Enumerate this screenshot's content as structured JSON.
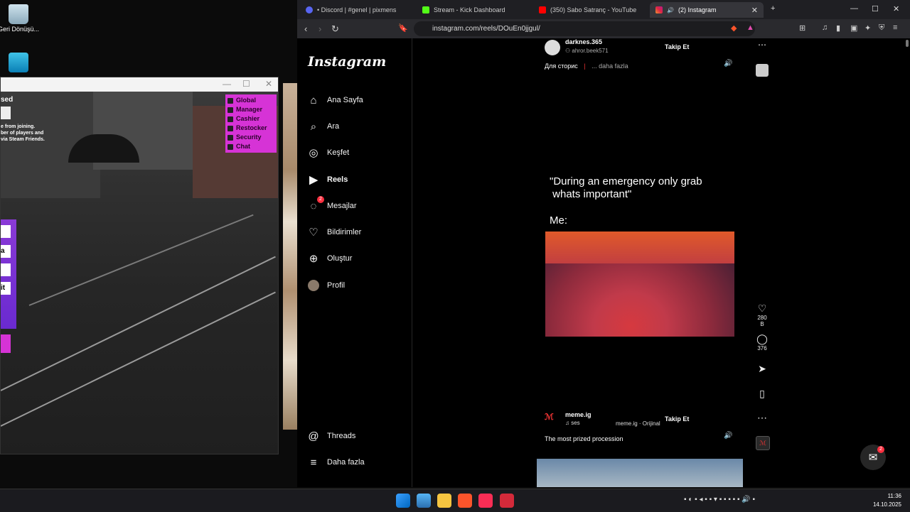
{
  "desktop": {
    "icons": [
      {
        "label": "Geri Dönüşü...",
        "icon": "recycle-bin-icon"
      },
      {
        "label": "",
        "icon": "monitor-icon"
      }
    ]
  },
  "game_window": {
    "title": "",
    "overlay_text": "sed",
    "info_lines": [
      "e from joining.",
      "ber of players and",
      "via Steam Friends."
    ],
    "menu": [
      {
        "label": "Global",
        "icon": "globe-icon"
      },
      {
        "label": "Manager",
        "icon": "user-icon"
      },
      {
        "label": "Cashier",
        "icon": "dollar-icon"
      },
      {
        "label": "Restocker",
        "icon": "box-icon"
      },
      {
        "label": "Security",
        "icon": "shield-icon"
      },
      {
        "label": "Chat",
        "icon": "chat-icon"
      }
    ],
    "side_panel": {
      "button_label": "it",
      "box_a": "",
      "box_b": "a"
    }
  },
  "browser": {
    "tabs": [
      {
        "label": "• Discord | #genel | pixmens",
        "icon": "discord-icon",
        "color": "#5865f2",
        "active": false
      },
      {
        "label": "Stream - Kick Dashboard",
        "icon": "kick-icon",
        "color": "#53fc18",
        "active": false
      },
      {
        "label": "(350) Sabo Satranç - YouTube",
        "icon": "youtube-icon",
        "color": "#ff0000",
        "active": false
      },
      {
        "label": "(2) Instagram",
        "icon": "instagram-icon",
        "color": "#e1306c",
        "active": true
      }
    ],
    "url": "instagram.com/reels/DOuEn0jjgul/"
  },
  "instagram": {
    "logo": "Instagram",
    "nav": [
      {
        "label": "Ana Sayfa",
        "icon": "home-icon"
      },
      {
        "label": "Ara",
        "icon": "search-icon"
      },
      {
        "label": "Keşfet",
        "icon": "compass-icon"
      },
      {
        "label": "Reels",
        "icon": "reels-icon"
      },
      {
        "label": "Mesajlar",
        "icon": "messenger-icon",
        "badge": "2"
      },
      {
        "label": "Bildirimler",
        "icon": "heart-icon"
      },
      {
        "label": "Oluştur",
        "icon": "plus-icon"
      },
      {
        "label": "Profil",
        "icon": "avatar-icon"
      }
    ],
    "nav_bottom": [
      {
        "label": "Threads",
        "icon": "threads-icon"
      },
      {
        "label": "Daha fazla",
        "icon": "menu-icon"
      }
    ],
    "reel1": {
      "username": "darknes.365",
      "audio": "ahror.beek571",
      "follow": "Takip Et",
      "caption": "Для сторис",
      "caption_sep": "|",
      "more": "... daha fazla",
      "text_top": "\"During an emergency only grab\n whats important\"",
      "text_me": "Me:",
      "likes": "280 B",
      "comments": "376"
    },
    "reel2": {
      "username": "meme.ig",
      "audio": "ses",
      "audio_original": "meme.ig · Orijinal",
      "follow": "Takip Et",
      "caption": "The most prized procession"
    },
    "messages_badge": "2"
  },
  "taskbar": {
    "time": "11:36",
    "date": "14.10.2025"
  }
}
